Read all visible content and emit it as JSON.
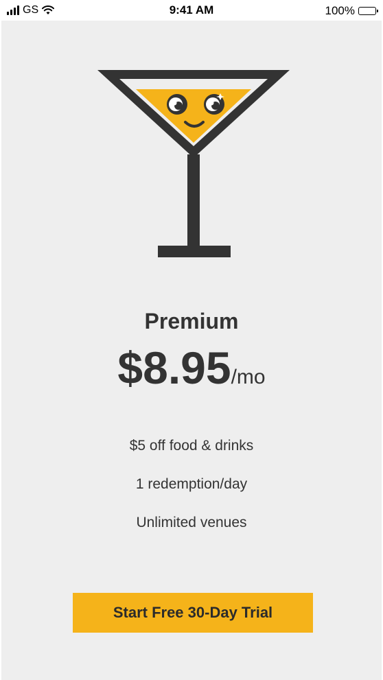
{
  "status_bar": {
    "carrier": "GS",
    "time": "9:41 AM",
    "battery": "100%"
  },
  "icons": {
    "signal": "signal-bars-icon",
    "wifi": "wifi-icon",
    "battery": "battery-icon",
    "mascot": "cocktail-glass-icon"
  },
  "colors": {
    "background": "#eeeeee",
    "accent": "#f5b31a",
    "text": "#333333"
  },
  "plan": {
    "name": "Premium",
    "price": "$8.95",
    "unit": "/mo",
    "features": [
      "$5 off food & drinks",
      "1 redemption/day",
      "Unlimited venues"
    ]
  },
  "cta": {
    "label": "Start Free 30-Day Trial"
  }
}
